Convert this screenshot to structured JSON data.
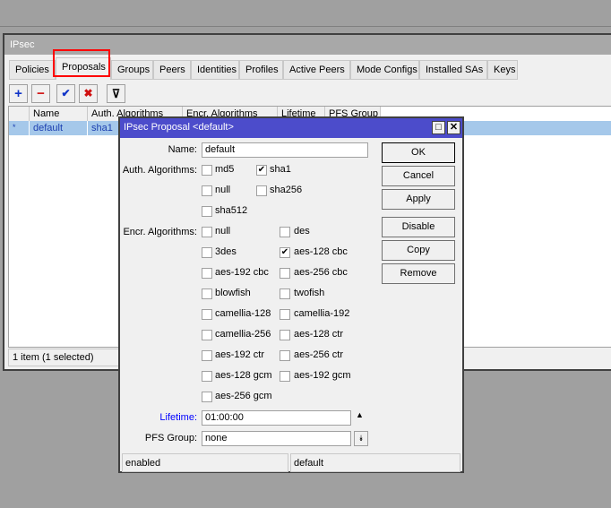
{
  "window": {
    "title": "IPsec"
  },
  "tabs": [
    "Policies",
    "Proposals",
    "Groups",
    "Peers",
    "Identities",
    "Profiles",
    "Active Peers",
    "Mode Configs",
    "Installed SAs",
    "Keys"
  ],
  "active_tab": "Proposals",
  "toolbar": {
    "add": "+",
    "remove": "−",
    "enable": "✔",
    "disable": "✖",
    "filter": "⊽"
  },
  "table": {
    "columns": [
      "Name",
      "Auth. Algorithms",
      "Encr. Algorithms",
      "Lifetime",
      "PFS Group"
    ],
    "rows": [
      {
        "flag": "*",
        "name": "default",
        "auth": "sha1"
      }
    ]
  },
  "status": "1 item (1 selected)",
  "dialog": {
    "title": "IPsec Proposal <default>",
    "maximize": "□",
    "close": "✕",
    "name_label": "Name:",
    "name_value": "default",
    "auth_label": "Auth. Algorithms:",
    "auth": [
      {
        "label": "md5",
        "checked": false
      },
      {
        "label": "sha1",
        "checked": true
      },
      {
        "label": "null",
        "checked": false
      },
      {
        "label": "sha256",
        "checked": false
      },
      {
        "label": "sha512",
        "checked": false
      }
    ],
    "encr_label": "Encr. Algorithms:",
    "encr": [
      {
        "label": "null",
        "checked": false
      },
      {
        "label": "des",
        "checked": false
      },
      {
        "label": "3des",
        "checked": false
      },
      {
        "label": "aes-128 cbc",
        "checked": true
      },
      {
        "label": "aes-192 cbc",
        "checked": false
      },
      {
        "label": "aes-256 cbc",
        "checked": false
      },
      {
        "label": "blowfish",
        "checked": false
      },
      {
        "label": "twofish",
        "checked": false
      },
      {
        "label": "camellia-128",
        "checked": false
      },
      {
        "label": "camellia-192",
        "checked": false
      },
      {
        "label": "camellia-256",
        "checked": false
      },
      {
        "label": "aes-128 ctr",
        "checked": false
      },
      {
        "label": "aes-192 ctr",
        "checked": false
      },
      {
        "label": "aes-256 ctr",
        "checked": false
      },
      {
        "label": "aes-128 gcm",
        "checked": false
      },
      {
        "label": "aes-192 gcm",
        "checked": false
      },
      {
        "label": "aes-256 gcm",
        "checked": false
      }
    ],
    "lifetime_label": "Lifetime:",
    "lifetime_value": "01:00:00",
    "pfs_label": "PFS Group:",
    "pfs_value": "none",
    "buttons": [
      "OK",
      "Cancel",
      "Apply",
      "Disable",
      "Copy",
      "Remove"
    ],
    "status_left": "enabled",
    "status_right": "default",
    "lifetime_color": "#0000ff"
  }
}
